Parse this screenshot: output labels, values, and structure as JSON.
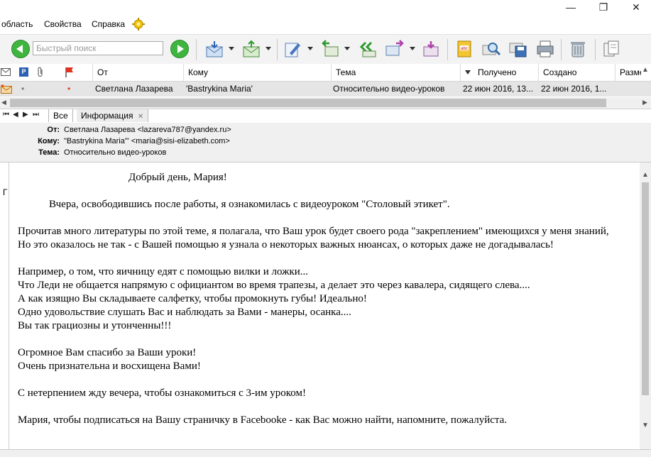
{
  "menu": {
    "items": [
      "область",
      "Свойства",
      "Справка"
    ]
  },
  "window": {
    "minimize": "—",
    "restore": "❐",
    "close": "✕"
  },
  "toolbar": {
    "search_placeholder": "Быстрый поиск"
  },
  "columns": {
    "from": "От",
    "to": "Кому",
    "subject": "Тема",
    "received": "Получено",
    "created": "Создано",
    "size": "Разме"
  },
  "message_row": {
    "from": "Светлана Лазарева",
    "to": "'Bastrykina Maria'",
    "subject": "Относительно видео-уроков",
    "received": "22 июн 2016, 13...",
    "created": "22 июн 2016, 1..."
  },
  "tabs": {
    "nav": [
      "⏮",
      "◀",
      "▶",
      "⏭"
    ],
    "all": "Все",
    "info": "Информация"
  },
  "header": {
    "from_label": "От:",
    "from_value": "Светлана Лазарева <lazareva787@yandex.ru>",
    "to_label": "Кому:",
    "to_value": "\"Bastrykina Maria'\" <maria@sisi-elizabeth.com>",
    "subject_label": "Тема:",
    "subject_value": "Относительно видео-уроков"
  },
  "body": {
    "side_letter": "Г",
    "greeting": "Добрый день, Мария!",
    "lines": [
      "Вчера, освободившись после работы, я ознакомилась с видеоуроком \"Столовый этикет\".",
      "",
      "Прочитав много литературы по этой теме, я полагала, что Ваш урок будет своего рода \"закреплением\" имеющихся у меня знаний,",
      "Но это оказалось не так - с Вашей помощью я узнала о некоторых важных нюансах, о которых даже не догадывалась!",
      "",
      "Например, о том, что яичницу едят с помощью вилки и ложки...",
      "Что Леди не общается напрямую с официантом во время трапезы, а делает это через кавалера, сидящего слева....",
      "А как изящно Вы складываете салфетку, чтобы промокнуть губы! Идеально!",
      "Одно удовольствие слушать Вас и наблюдать за Вами - манеры, осанка....",
      "Вы так грациозны и утонченны!!!",
      "",
      "Огромное Вам спасибо за Ваши уроки!",
      "Очень признательна и восхищена Вами!",
      "",
      "С нетерпением жду вечера, чтобы ознакомиться с 3-им уроком!",
      "",
      "Мария, чтобы подписаться на Вашу страничку в Facebooke - как Вас можно найти, напомните, пожалуйста."
    ]
  },
  "colors": {
    "accent": "#3fb53f",
    "selected_row": "#e5e5e5",
    "header_pane": "#f0f0f0",
    "flag": "#e0331f"
  }
}
